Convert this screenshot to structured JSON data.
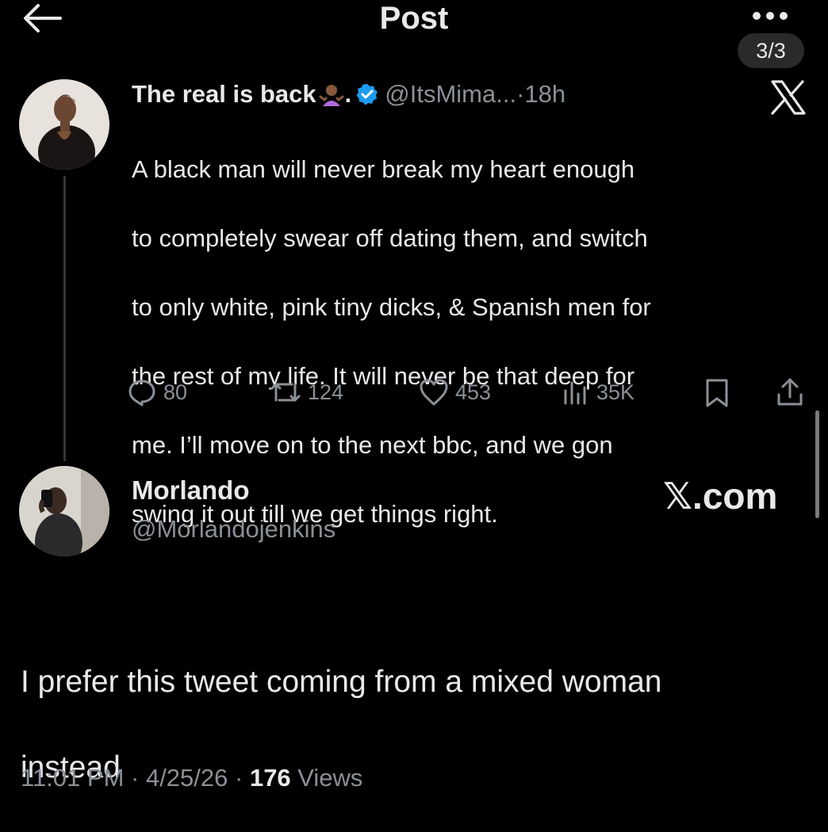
{
  "header": {
    "title": "Post",
    "page_indicator": "3/3"
  },
  "tweet": {
    "display_name": "The real is back",
    "name_suffix": ".",
    "handle": "@ItsMima...",
    "separator": " · ",
    "time": "18h",
    "lines": [
      "A black man will never break my heart enough",
      "to completely swear off dating them, and switch",
      "to only white, pink tiny dicks, & Spanish men for",
      "the rest of my life. It will never be that deep for",
      "me. I’ll move on to the next bbc, and we gon",
      "swing it out till we get things right."
    ],
    "stats": {
      "replies": "80",
      "reposts": "124",
      "likes": "453",
      "views": "35K"
    },
    "emoji": "woman-shrugging-emoji"
  },
  "reply": {
    "display_name": "Morlando",
    "handle": "@Morlandojenkins",
    "brand": "𝕏.com",
    "lines": [
      "I prefer this tweet coming from a mixed woman",
      "instead"
    ],
    "time": "11:01 PM",
    "date": "4/25/26",
    "dot": " · ",
    "views_count": "176",
    "views_label": " Views"
  },
  "colors": {
    "background": "#000000",
    "text": "#e7e9ea",
    "secondary": "#8b9096",
    "verified": "#1d9bf0"
  },
  "icons": [
    "back-arrow-icon",
    "more-icon",
    "verified-icon",
    "x-logo-icon",
    "reply-icon",
    "repost-icon",
    "like-icon",
    "views-icon",
    "bookmark-icon",
    "share-icon"
  ]
}
